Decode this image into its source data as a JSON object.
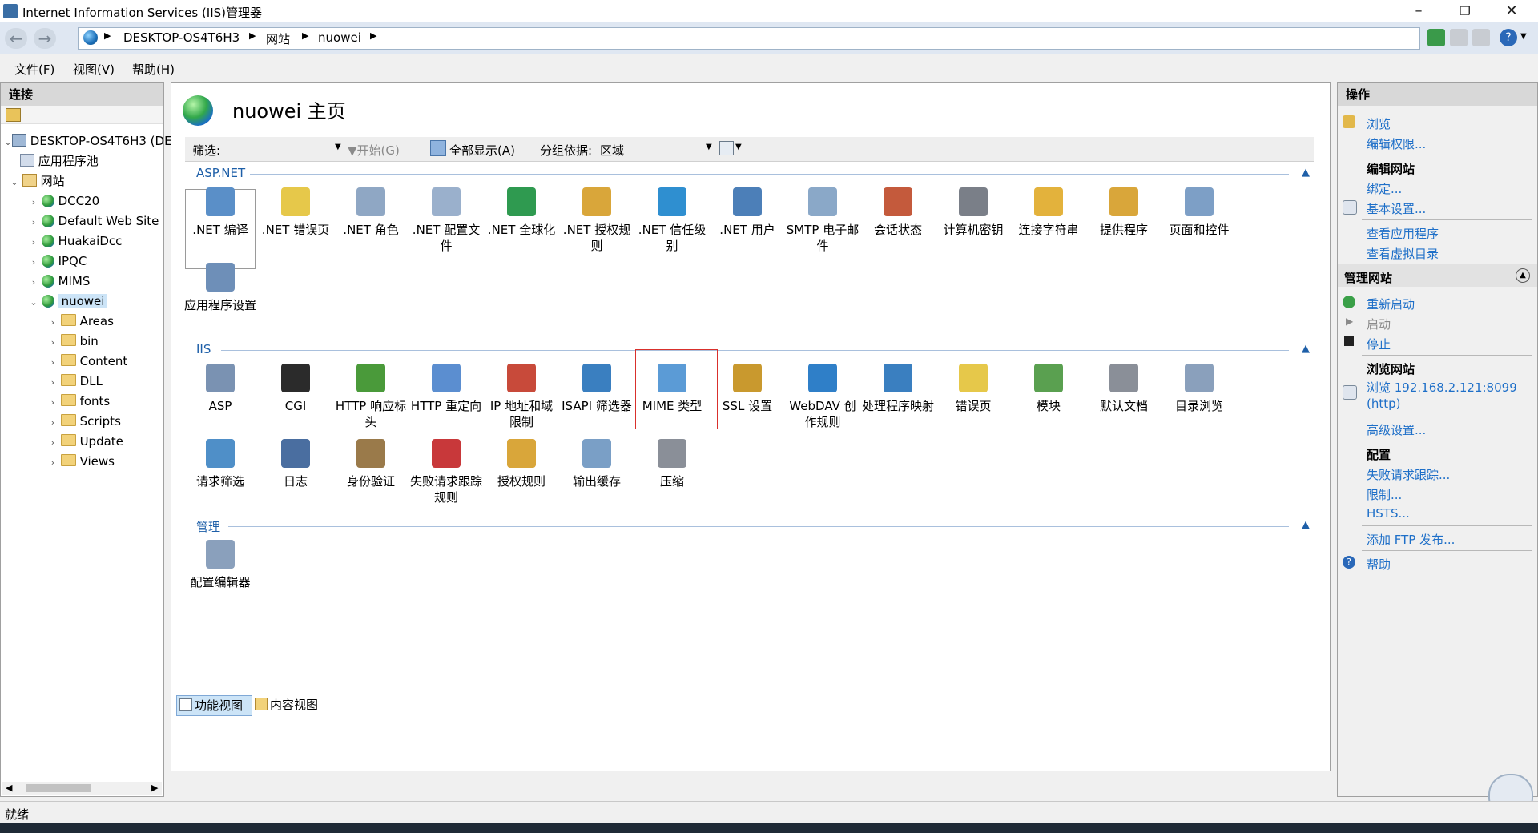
{
  "window": {
    "title": "Internet Information Services (IIS)管理器"
  },
  "breadcrumb": [
    "DESKTOP-OS4T6H3",
    "网站",
    "nuowei"
  ],
  "menu": [
    "文件(F)",
    "视图(V)",
    "帮助(H)"
  ],
  "connections": {
    "header": "连接",
    "server": "DESKTOP-OS4T6H3 (DE",
    "app_pools": "应用程序池",
    "sites_label": "网站",
    "sites": [
      "DCC20",
      "Default Web Site",
      "HuakaiDcc",
      "IPQC",
      "MIMS",
      "nuowei"
    ],
    "folders": [
      "Areas",
      "bin",
      "Content",
      "DLL",
      "fonts",
      "Scripts",
      "Update",
      "Views"
    ]
  },
  "page": {
    "title": "nuowei 主页",
    "filter_label": "筛选:",
    "start_label": "开始(G)",
    "show_all_label": "全部显示(A)",
    "group_by_label": "分组依据:",
    "group_by_value": "区域"
  },
  "groups": {
    "aspnet": {
      "title": "ASP.NET",
      "features": [
        {
          "label": ".NET 编译",
          "icon": "net-compile-icon",
          "color": "#5a8fc8"
        },
        {
          "label": ".NET 错误页",
          "icon": "net-error-page-icon",
          "color": "#e6c84a"
        },
        {
          "label": ".NET 角色",
          "icon": "net-roles-icon",
          "color": "#8fa7c4"
        },
        {
          "label": ".NET 配置文件",
          "icon": "net-profile-icon",
          "color": "#9ab0cc"
        },
        {
          "label": ".NET 全球化",
          "icon": "net-globalization-icon",
          "color": "#2f9a50"
        },
        {
          "label": ".NET 授权规则",
          "icon": "net-authorization-icon",
          "color": "#d9a63a"
        },
        {
          "label": ".NET 信任级别",
          "icon": "net-trust-icon",
          "color": "#2f8fd0"
        },
        {
          "label": ".NET 用户",
          "icon": "net-users-icon",
          "color": "#4c7fb8"
        },
        {
          "label": "SMTP 电子邮件",
          "icon": "smtp-email-icon",
          "color": "#8aa8c8"
        },
        {
          "label": "会话状态",
          "icon": "session-state-icon",
          "color": "#c45a3c"
        },
        {
          "label": "计算机密钥",
          "icon": "machine-key-icon",
          "color": "#7a7f88"
        },
        {
          "label": "连接字符串",
          "icon": "connection-strings-icon",
          "color": "#e3b23c"
        },
        {
          "label": "提供程序",
          "icon": "providers-icon",
          "color": "#d9a63a"
        },
        {
          "label": "页面和控件",
          "icon": "pages-controls-icon",
          "color": "#7d9fc6"
        },
        {
          "label": "应用程序设置",
          "icon": "app-settings-icon",
          "color": "#6e8fb8"
        }
      ]
    },
    "iis": {
      "title": "IIS",
      "features": [
        {
          "label": "ASP",
          "icon": "asp-icon",
          "color": "#7a92b2"
        },
        {
          "label": "CGI",
          "icon": "cgi-icon",
          "color": "#2b2b2b"
        },
        {
          "label": "HTTP 响应标头",
          "icon": "http-headers-icon",
          "color": "#4a9a3a"
        },
        {
          "label": "HTTP 重定向",
          "icon": "http-redirect-icon",
          "color": "#5b8ed0"
        },
        {
          "label": "IP 地址和域限制",
          "icon": "ip-restrictions-icon",
          "color": "#c84a3a"
        },
        {
          "label": "ISAPI 筛选器",
          "icon": "isapi-filters-icon",
          "color": "#3a7fc0"
        },
        {
          "label": "MIME 类型",
          "icon": "mime-types-icon",
          "color": "#5b9bd6"
        },
        {
          "label": "SSL 设置",
          "icon": "ssl-lock-icon",
          "color": "#c9992e"
        },
        {
          "label": "WebDAV 创作规则",
          "icon": "webdav-icon",
          "color": "#2f7fc8"
        },
        {
          "label": "处理程序映射",
          "icon": "handler-mappings-icon",
          "color": "#3a7fc0"
        },
        {
          "label": "错误页",
          "icon": "error-pages-icon",
          "color": "#e6c84a"
        },
        {
          "label": "模块",
          "icon": "modules-icon",
          "color": "#5aa050"
        },
        {
          "label": "默认文档",
          "icon": "default-document-icon",
          "color": "#8a8f98"
        },
        {
          "label": "目录浏览",
          "icon": "directory-browsing-icon",
          "color": "#8aa0bc"
        },
        {
          "label": "请求筛选",
          "icon": "request-filtering-icon",
          "color": "#4f8fc8"
        },
        {
          "label": "日志",
          "icon": "logging-icon",
          "color": "#4a6ea0"
        },
        {
          "label": "身份验证",
          "icon": "authentication-icon",
          "color": "#9a7a4a"
        },
        {
          "label": "失败请求跟踪规则",
          "icon": "failed-request-tracing-icon",
          "color": "#c8383a"
        },
        {
          "label": "授权规则",
          "icon": "authorization-rules-icon",
          "color": "#d9a63a"
        },
        {
          "label": "输出缓存",
          "icon": "output-caching-icon",
          "color": "#7a9fc6"
        },
        {
          "label": "压缩",
          "icon": "compression-icon",
          "color": "#8a8f98"
        }
      ]
    },
    "management": {
      "title": "管理",
      "features": [
        {
          "label": "配置编辑器",
          "icon": "config-editor-icon",
          "color": "#8aa0bc"
        }
      ]
    }
  },
  "tabs": {
    "features_view": "功能视图",
    "content_view": "内容视图"
  },
  "actions": {
    "header": "操作",
    "browse": "浏览",
    "edit_permissions": "编辑权限...",
    "edit_site": "编辑网站",
    "bindings": "绑定...",
    "basic_settings": "基本设置...",
    "view_apps": "查看应用程序",
    "view_vdirs": "查看虚拟目录",
    "manage_site": "管理网站",
    "restart": "重新启动",
    "start": "启动",
    "stop": "停止",
    "browse_site": "浏览网站",
    "browse_url": "浏览 192.168.2.121:8099",
    "browse_url_proto": "(http)",
    "advanced_settings": "高级设置...",
    "config": "配置",
    "failed_request_tracing": "失败请求跟踪...",
    "limits": "限制...",
    "hsts": "HSTS...",
    "add_ftp": "添加 FTP 发布...",
    "help": "帮助"
  },
  "status": {
    "text": "就绪"
  },
  "colors": {
    "link": "#1e6fc8",
    "group": "#1e5fa8",
    "selected": "#cce4f7",
    "mime_highlight": "#d9302c"
  }
}
